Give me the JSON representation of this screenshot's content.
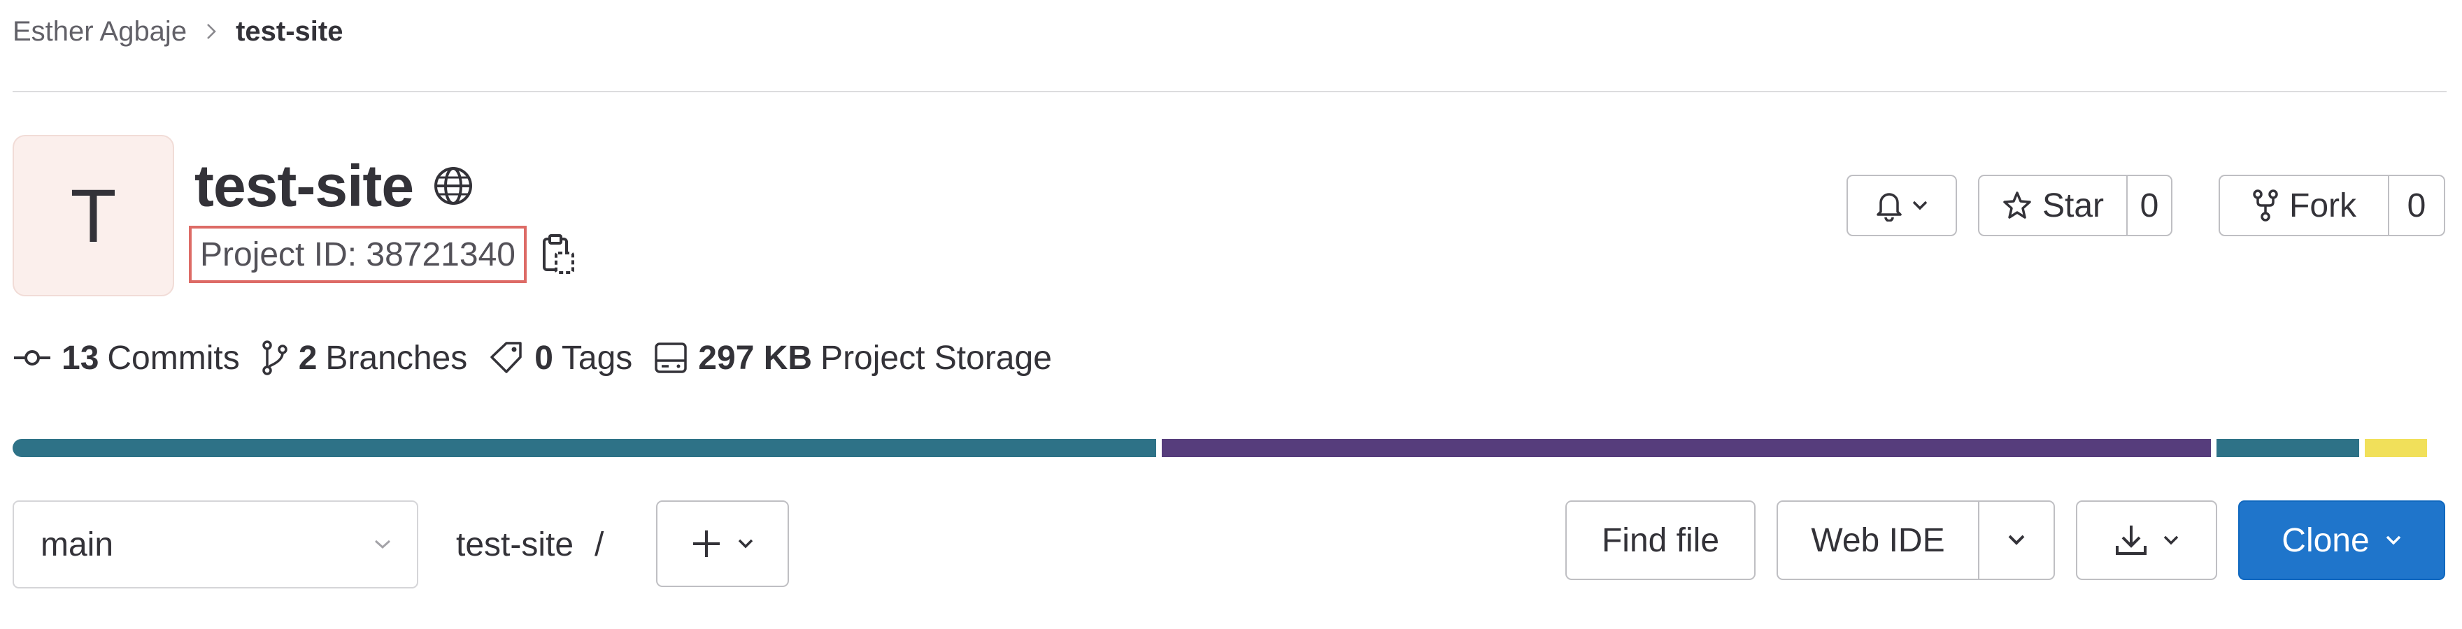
{
  "breadcrumb": {
    "owner": "Esther Agbaje",
    "project": "test-site"
  },
  "project": {
    "avatar_letter": "T",
    "title": "test-site",
    "visibility_icon": "globe-icon",
    "project_id_label": "Project ID: 38721340"
  },
  "actions": {
    "notifications_icon": "bell-icon",
    "star_label": "Star",
    "star_count": "0",
    "fork_label": "Fork",
    "fork_count": "0"
  },
  "stats": {
    "commits_count": "13",
    "commits_label": "Commits",
    "branches_count": "2",
    "branches_label": "Branches",
    "tags_count": "0",
    "tags_label": "Tags",
    "storage_size": "297 KB",
    "storage_label": "Project Storage"
  },
  "languages": [
    {
      "color": "#2e7287",
      "fraction": 0.473
    },
    {
      "color": "#563d7c",
      "fraction": 0.434
    },
    {
      "color": "#2e7287",
      "fraction": 0.059
    },
    {
      "color": "#f1e05a",
      "fraction": 0.026
    }
  ],
  "repo": {
    "branch": "main",
    "path_root": "test-site",
    "path_separator": "/",
    "find_file_label": "Find file",
    "web_ide_label": "Web IDE",
    "clone_label": "Clone"
  },
  "colors": {
    "primary": "#1f75cb",
    "border": "#bfbfc3",
    "avatar_bg": "#fbefec",
    "highlight_box": "#dd6b66"
  }
}
